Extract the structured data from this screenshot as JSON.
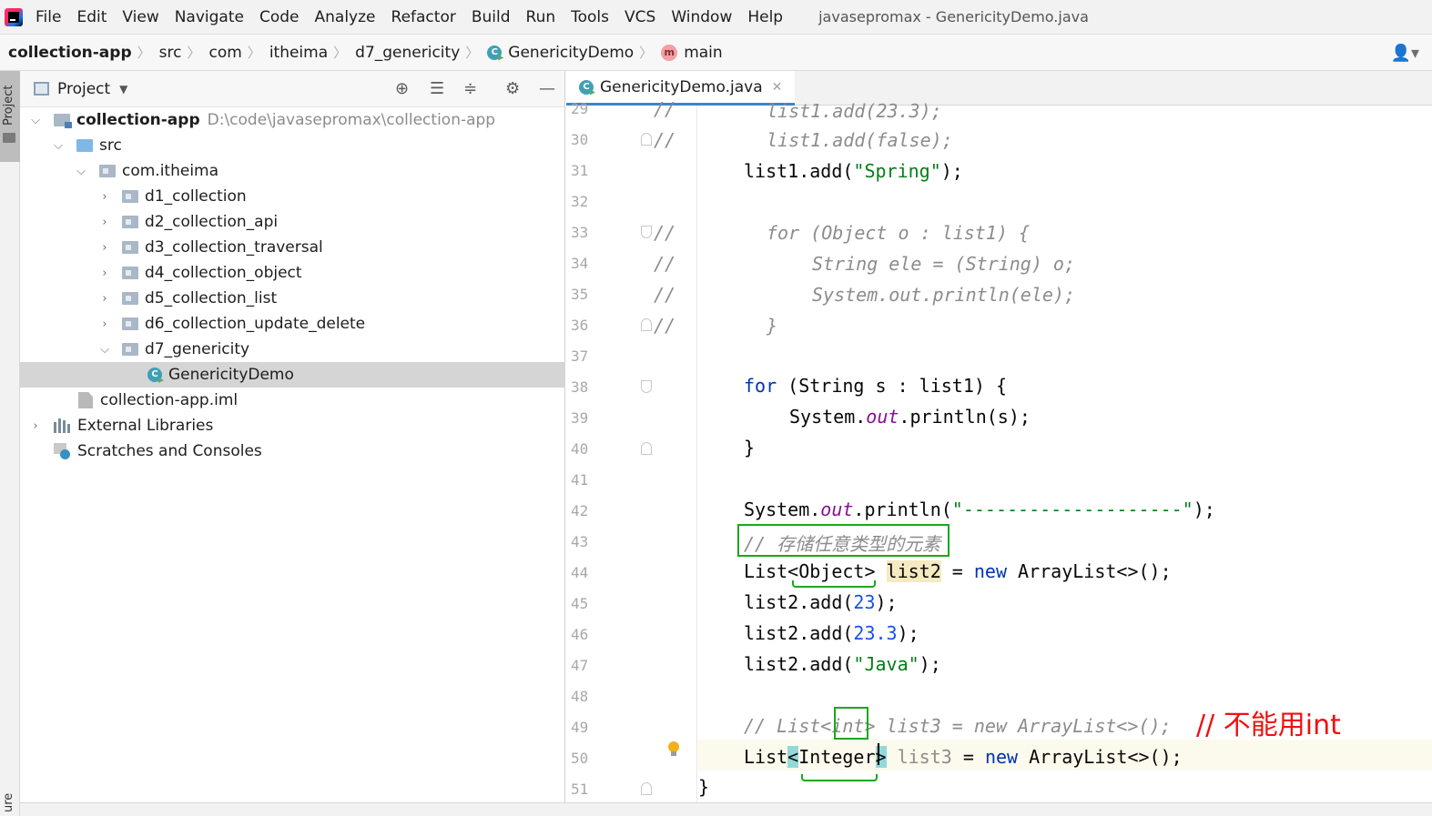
{
  "menu": {
    "items": [
      "File",
      "Edit",
      "View",
      "Navigate",
      "Code",
      "Analyze",
      "Refactor",
      "Build",
      "Run",
      "Tools",
      "VCS",
      "Window",
      "Help"
    ],
    "window_title": "javasepromax - GenericityDemo.java"
  },
  "breadcrumb": {
    "items": [
      "collection-app",
      "src",
      "com",
      "itheima",
      "d7_genericity",
      "GenericityDemo",
      "main"
    ]
  },
  "left_strip": {
    "project_label": "Project",
    "bottom_label": "ure"
  },
  "project_panel": {
    "title": "Project",
    "tree": [
      {
        "label": "collection-app",
        "path": "D:\\code\\javasepromax\\collection-app"
      },
      {
        "label": "src"
      },
      {
        "label": "com.itheima"
      },
      {
        "label": "d1_collection"
      },
      {
        "label": "d2_collection_api"
      },
      {
        "label": "d3_collection_traversal"
      },
      {
        "label": "d4_collection_object"
      },
      {
        "label": "d5_collection_list"
      },
      {
        "label": "d6_collection_update_delete"
      },
      {
        "label": "d7_genericity"
      },
      {
        "label": "GenericityDemo"
      },
      {
        "label": "collection-app.iml"
      },
      {
        "label": "External Libraries"
      },
      {
        "label": "Scratches and Consoles"
      }
    ]
  },
  "editor": {
    "tab_label": "GenericityDemo.java",
    "line_numbers": [
      "29",
      "30",
      "31",
      "32",
      "33",
      "34",
      "35",
      "36",
      "37",
      "38",
      "39",
      "40",
      "41",
      "42",
      "43",
      "44",
      "45",
      "46",
      "47",
      "48",
      "49",
      "50",
      "51"
    ],
    "gutter_comment": "//",
    "code": {
      "l29": "list1.add(23.3);",
      "l30": "list1.add(false);",
      "l31_a": "list1.add(",
      "l31_s": "\"Spring\"",
      "l31_b": ");",
      "l33": "for (Object o : list1) {",
      "l34": "String ele = (String) o;",
      "l35": "System.out.println(ele);",
      "l36": "}",
      "l38_kw": "for",
      "l38_rest": " (String s : list1) {",
      "l39_a": "System.",
      "l39_it": "out",
      "l39_b": ".println(s);",
      "l40": "}",
      "l42_a": "System.",
      "l42_it": "out",
      "l42_b": ".println(",
      "l42_s": "\"--------------------\"",
      "l42_c": ");",
      "l43": "// 存储任意类型的元素",
      "l44_a": "List<Object> ",
      "l44_var": "list2",
      "l44_b": " = ",
      "l44_kw": "new",
      "l44_c": " ArrayList<>();",
      "l45_a": "list2.add(",
      "l45_n": "23",
      "l45_b": ");",
      "l46_a": "list2.add(",
      "l46_n": "23.3",
      "l46_b": ");",
      "l47_a": "list2.add(",
      "l47_s": "\"Java\"",
      "l47_b": ");",
      "l49": "// List<int> list3 = new ArrayList<>();",
      "l50_a": "List",
      "l50_lt": "<",
      "l50_type": "Integer",
      "l50_gt": ">",
      "l50_var": " list3",
      "l50_b": " = ",
      "l50_kw": "new",
      "l50_c": " ArrayList<>();",
      "l51": "}"
    }
  },
  "annotation": {
    "text": "// 不能用int",
    "color": "#f01010"
  },
  "colors": {
    "keyword": "#0033b3",
    "string": "#067d17",
    "number": "#1750eb",
    "comment": "#8c8c8c",
    "annotation_box": "#1aa81a"
  },
  "icons": {
    "user": "user-icon",
    "locate": "crosshair-icon",
    "expand": "expand-all-icon",
    "collapse": "collapse-all-icon",
    "settings": "gear-icon",
    "hide": "minimize-icon",
    "bulb": "lightbulb-icon"
  }
}
